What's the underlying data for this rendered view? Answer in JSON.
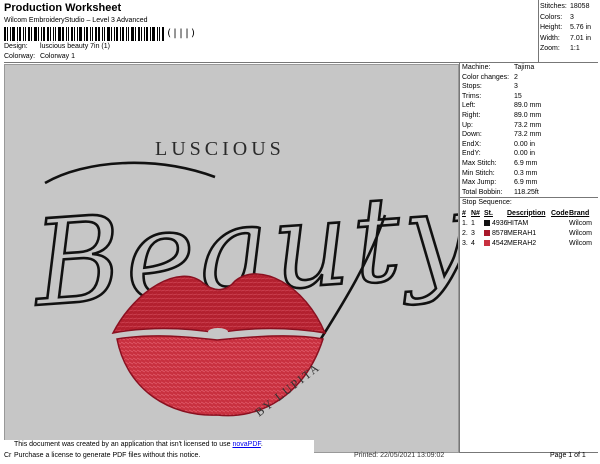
{
  "header": {
    "title": "Production Worksheet",
    "software": "Wilcom EmbroideryStudio – Level 3 Advanced",
    "barcode_glyph": "(|||)",
    "design_label": "Design:",
    "design_value": "luscious beauty 7in (1)",
    "colorway_label": "Colorway:",
    "colorway_value": "Colorway 1"
  },
  "stats": [
    {
      "k": "Stitches:",
      "v": "18058"
    },
    {
      "k": "Colors:",
      "v": "3"
    },
    {
      "k": "Height:",
      "v": "5.76 in"
    },
    {
      "k": "Width:",
      "v": "7.01 in"
    },
    {
      "k": "Zoom:",
      "v": "1:1"
    }
  ],
  "machine": [
    {
      "k": "Machine:",
      "v": "Tajima"
    },
    {
      "k": "Color changes:",
      "v": "2"
    },
    {
      "k": "Stops:",
      "v": "3"
    },
    {
      "k": "Trims:",
      "v": "15"
    },
    {
      "k": "Left:",
      "v": "89.0 mm"
    },
    {
      "k": "Right:",
      "v": "89.0 mm"
    },
    {
      "k": "Up:",
      "v": "73.2 mm"
    },
    {
      "k": "Down:",
      "v": "73.2 mm"
    },
    {
      "k": "EndX:",
      "v": "0.00 in"
    },
    {
      "k": "EndY:",
      "v": "0.00 in"
    },
    {
      "k": "Max Stitch:",
      "v": "6.9 mm"
    },
    {
      "k": "Min Stitch:",
      "v": "0.3 mm"
    },
    {
      "k": "Max Jump:",
      "v": "6.9 mm"
    },
    {
      "k": "Total Bobbin:",
      "v": "118.25ft"
    }
  ],
  "stop_sequence": {
    "title": "Stop Sequence:",
    "headers": [
      "#",
      "N#",
      "St.",
      "Description",
      "Code",
      "Brand"
    ],
    "rows": [
      {
        "n": "1.",
        "nn": "1",
        "color": "#111111",
        "st": "4936",
        "desc": "HITAM",
        "code": "",
        "brand": "Wilcom"
      },
      {
        "n": "2.",
        "nn": "3",
        "color": "#a8192a",
        "st": "8578",
        "desc": "MERAH1",
        "code": "",
        "brand": "Wilcom"
      },
      {
        "n": "3.",
        "nn": "4",
        "color": "#c8303f",
        "st": "4542",
        "desc": "MERAH2",
        "code": "",
        "brand": "Wilcom"
      }
    ]
  },
  "design_art": {
    "text_luscious": "LUSCIOUS",
    "text_beauty": "Beauty",
    "text_by": "BY LUPITA",
    "thread_dark": "#111111",
    "lip_color_1": "#a8192a",
    "lip_color_2": "#c8303f"
  },
  "footer": {
    "notice_line1_pre": "This document was created by an application that isn't licensed to use ",
    "notice_link": "novaPDF",
    "notice_line1_post": ".",
    "notice_line2": "Purchase a license to generate PDF files without this notice.",
    "cr": "Cr",
    "printed": "Printed: 22/05/2021 13:09:02",
    "page": "Page 1 of 1"
  }
}
